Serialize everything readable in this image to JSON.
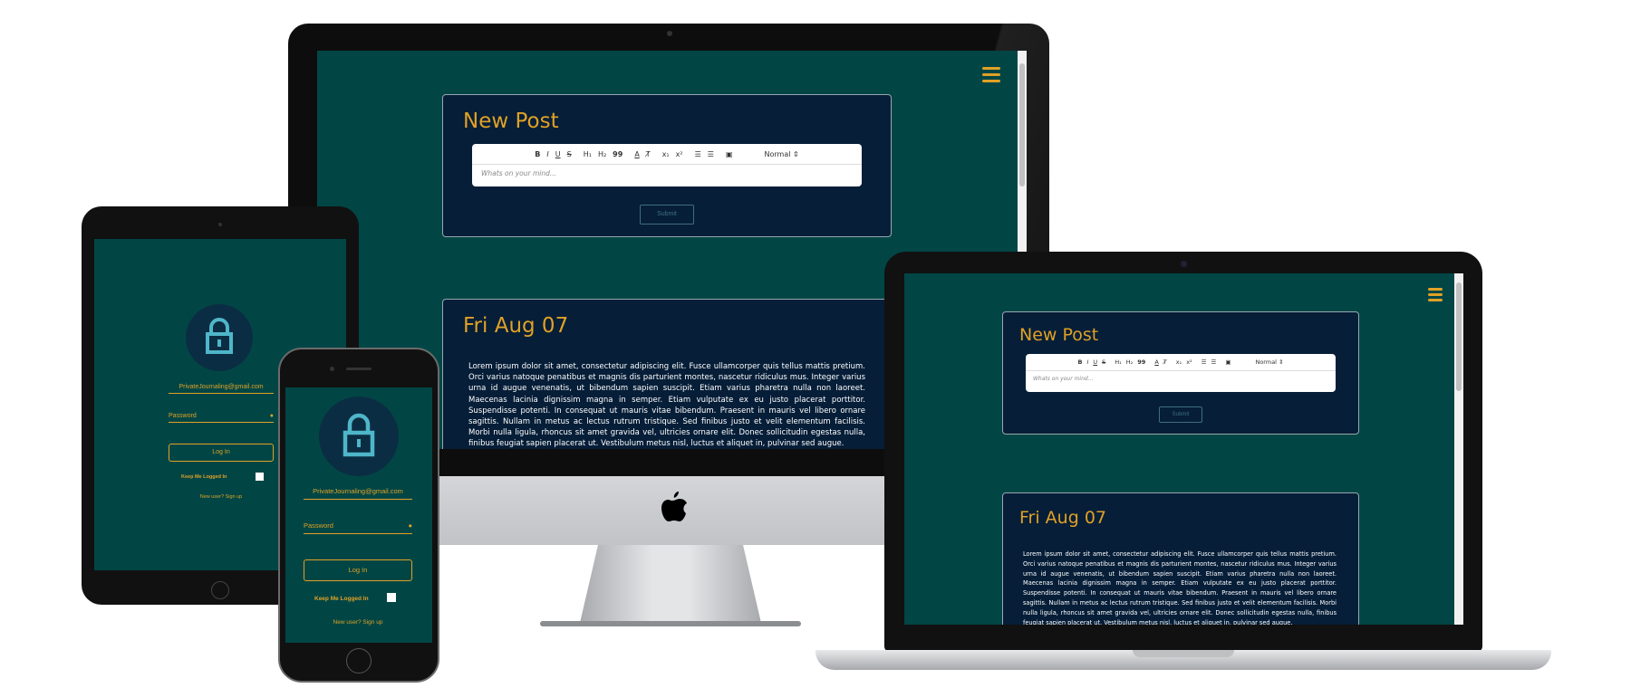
{
  "imac": {
    "new_post": {
      "title": "New Post",
      "placeholder": "Whats on your mind...",
      "submit_label": "Submit",
      "size_select": "Normal"
    },
    "post": {
      "date": "Fri Aug 07",
      "body": "Lorem ipsum dolor sit amet, consectetur adipiscing elit. Fusce ullamcorper quis tellus mattis pretium. Orci varius natoque penatibus et magnis dis parturient montes, nascetur ridiculus mus. Integer varius urna id augue venenatis, ut bibendum sapien suscipit. Etiam varius pharetra nulla non laoreet. Maecenas lacinia dignissim magna in semper. Etiam vulputate ex eu justo placerat porttitor. Suspendisse potenti. In consequat ut mauris vitae bibendum. Praesent in mauris vel libero ornare sagittis. Nullam in metus ac lectus rutrum tristique. Sed finibus justo et velit elementum facilisis. Morbi nulla ligula, rhoncus sit amet gravida vel, ultricies ornare elit. Donec sollicitudin egestas nulla, finibus feugiat sapien placerat ut. Vestibulum metus nisl, luctus et aliquet in, pulvinar sed augue."
    }
  },
  "laptop": {
    "new_post": {
      "title": "New Post",
      "placeholder": "Whats on your mind...",
      "submit_label": "Submit",
      "size_select": "Normal"
    },
    "post": {
      "date": "Fri Aug 07",
      "body": "Lorem ipsum dolor sit amet, consectetur adipiscing elit. Fusce ullamcorper quis tellus mattis pretium. Orci varius natoque penatibus et magnis dis parturient montes, nascetur ridiculus mus. Integer varius urna id augue venenatis, ut bibendum sapien suscipit. Etiam varius pharetra nulla non laoreet. Maecenas lacinia dignissim magna in semper. Etiam vulputate ex eu justo placerat porttitor. Suspendisse potenti. In consequat ut mauris vitae bibendum. Praesent in mauris vel libero ornare sagittis. Nullam in metus ac lectus rutrum tristique. Sed finibus justo et velit elementum facilisis. Morbi nulla ligula, rhoncus sit amet gravida vel, ultricies ornare elit. Donec sollicitudin egestas nulla, finibus feugiat sapien placerat ut. Vestibulum metus nisl, luctus et aliquet in, pulvinar sed augue."
    }
  },
  "toolbar": {
    "bold": "B",
    "italic": "I",
    "underline": "U",
    "strike": "S",
    "h1": "H₁",
    "h2": "H₂",
    "quote": "99",
    "color": "A",
    "clean": "T̸",
    "sub": "x₁",
    "sup": "x²",
    "ol": "☰",
    "ul": "☰",
    "video": "▣"
  },
  "tablet": {
    "email": "PrivateJournaling@gmail.com",
    "password_placeholder": "Password",
    "login_label": "Log In",
    "keep_logged_in": "Keep Me Logged In",
    "signup": "New user? Sign up"
  },
  "phone": {
    "email": "PrivateJournaling@gmail.com",
    "password_placeholder": "Password",
    "login_label": "Log In",
    "keep_logged_in": "Keep Me Logged In",
    "signup": "New user? Sign up"
  },
  "colors": {
    "page_bg": "#014645",
    "panel_bg": "#061e38",
    "accent": "#e0a126",
    "submit": "#3f6f7c"
  }
}
